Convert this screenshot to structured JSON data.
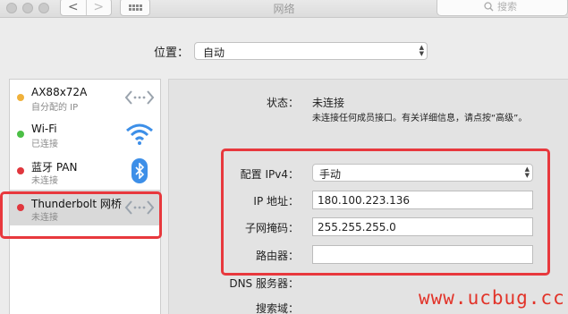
{
  "window": {
    "title": "网络",
    "search_placeholder": "搜索",
    "back_glyph": "<",
    "forward_glyph": ">"
  },
  "location": {
    "label": "位置：",
    "value": "自动"
  },
  "services": [
    {
      "name": "AX88x72A",
      "status": "自分配的 IP",
      "dot_color": "#f0b13b",
      "icon": "ethernet-arrows-icon"
    },
    {
      "name": "Wi-Fi",
      "status": "已连接",
      "dot_color": "#4cbf46",
      "icon": "wifi-icon"
    },
    {
      "name": "蓝牙 PAN",
      "status": "未连接",
      "dot_color": "#e0363d",
      "icon": "bluetooth-icon"
    },
    {
      "name": "Thunderbolt 网桥",
      "status": "未连接",
      "dot_color": "#e0363d",
      "icon": "ethernet-arrows-icon",
      "selected": true
    }
  ],
  "detail": {
    "status_label": "状态：",
    "status_value": "未连接",
    "status_desc": "未连接任何成员接口。有关详细信息，请点按“高级”。",
    "configure_label": "配置 IPv4：",
    "configure_value": "手动",
    "ip_label": "IP 地址：",
    "ip_value": "180.100.223.136",
    "mask_label": "子网掩码：",
    "mask_value": "255.255.255.0",
    "router_label": "路由器：",
    "router_value": "",
    "dns_label": "DNS 服务器：",
    "search_domain_label": "搜索域："
  },
  "watermark": "www.ucbug.cc",
  "colors": {
    "highlight": "#e8383d",
    "selected_row": "#d9d9d9",
    "bluetooth": "#3d8fe8",
    "wifi": "#3d8fe8"
  }
}
